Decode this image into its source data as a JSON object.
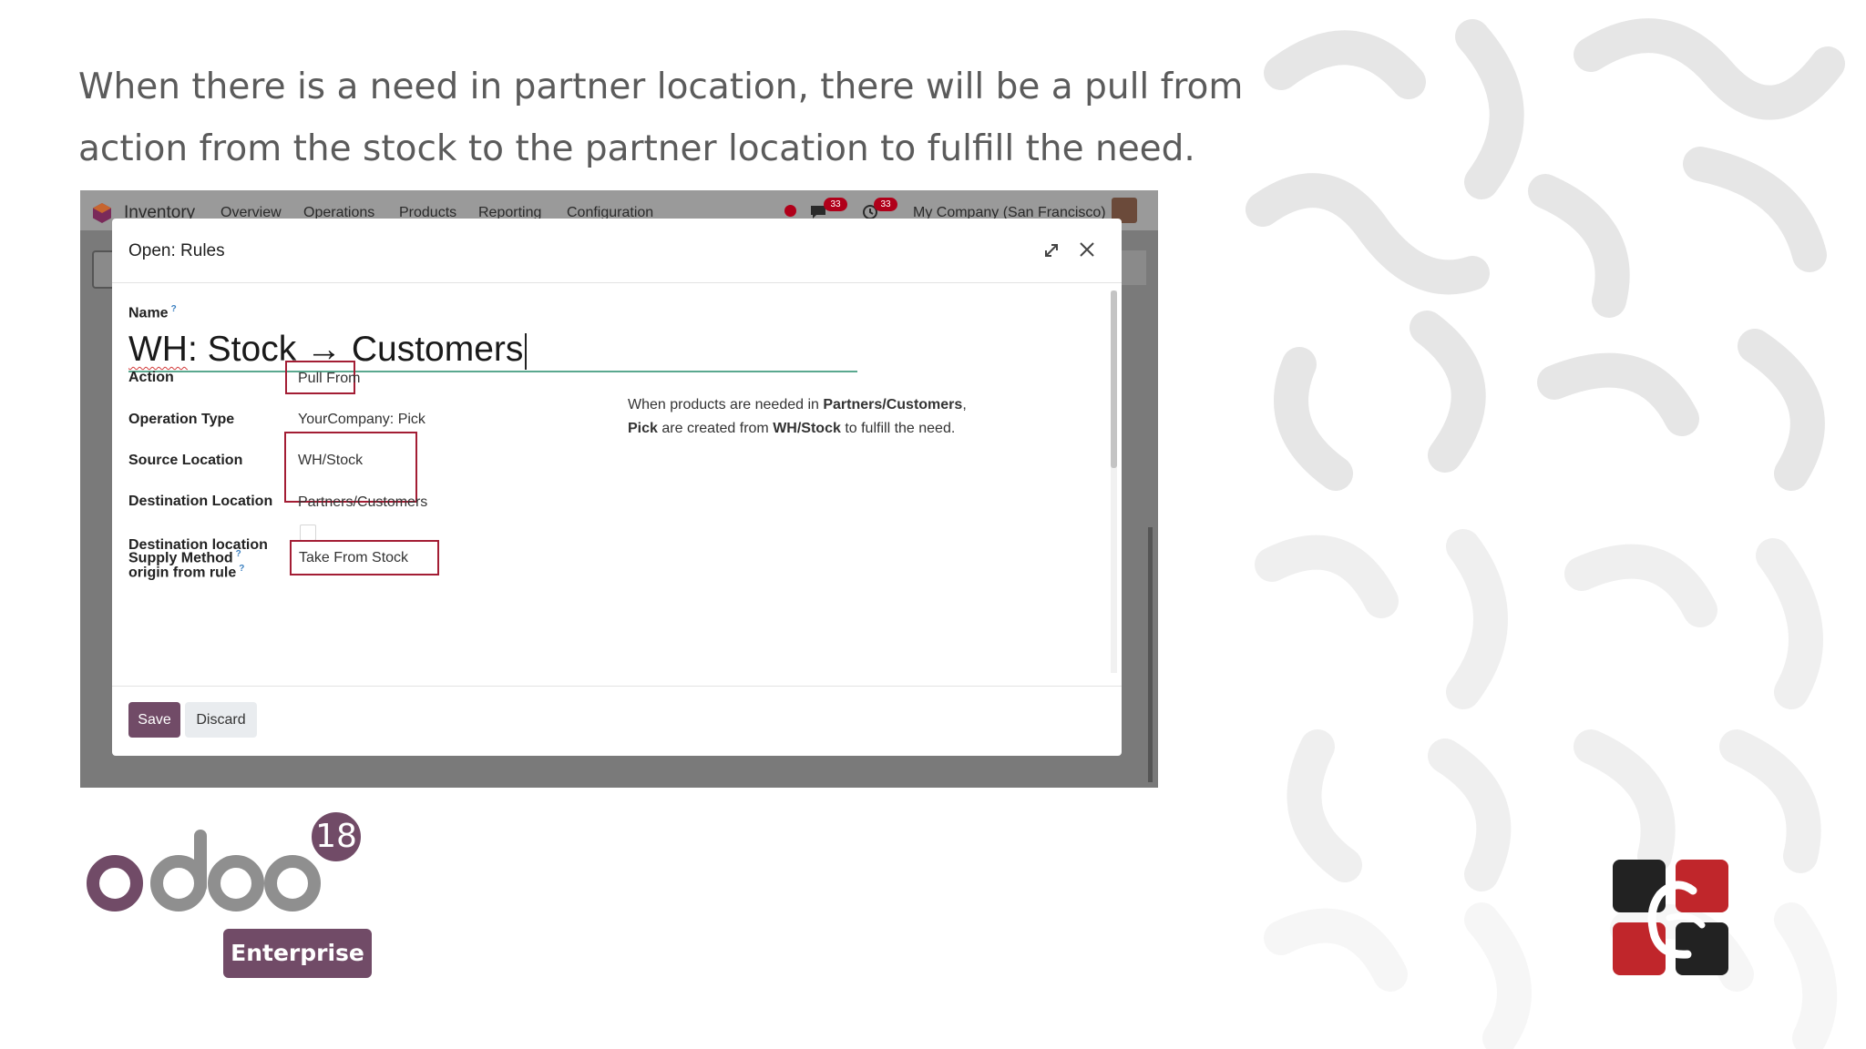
{
  "slide": {
    "heading_line1": "When there is a need in partner location, there will be a pull from",
    "heading_line2": "action from the stock to the partner location to fulfill the need."
  },
  "topbar": {
    "app_name": "Inventory",
    "menu": [
      "Overview",
      "Operations",
      "Products",
      "Reporting",
      "Configuration"
    ],
    "messages_count": "33",
    "activities_count": "33",
    "company": "My Company (San Francisco)"
  },
  "dialog": {
    "title": "Open: Rules",
    "name_label": "Name",
    "name_value_prefix": "WH",
    "name_value_rest": ": Stock → Customers",
    "fields": {
      "action_label": "Action",
      "action_value": "Pull From",
      "operation_type_label": "Operation Type",
      "operation_type_value": "YourCompany: Pick",
      "source_location_label": "Source Location",
      "source_location_value": "WH/Stock",
      "destination_location_label": "Destination Location",
      "destination_location_value": "Partners/Customers",
      "dest_origin_label_line1": "Destination location",
      "dest_origin_label_line2": "origin from rule",
      "dest_origin_checked": false,
      "supply_method_label": "Supply Method",
      "supply_method_value": "Take From Stock"
    },
    "help": {
      "t1": "When products are needed in ",
      "b1": "Partners/Customers",
      "t2": ",",
      "b2": "Pick",
      "t3": " are created from ",
      "b3": "WH/Stock",
      "t4": " to fulfill the need."
    },
    "save_label": "Save",
    "discard_label": "Discard"
  },
  "branding": {
    "odoo_version": "18",
    "edition": "Enterprise"
  },
  "colors": {
    "odoo_purple": "#714b67",
    "highlight_border": "#a31d34",
    "heading_text": "#5b5b5b"
  }
}
